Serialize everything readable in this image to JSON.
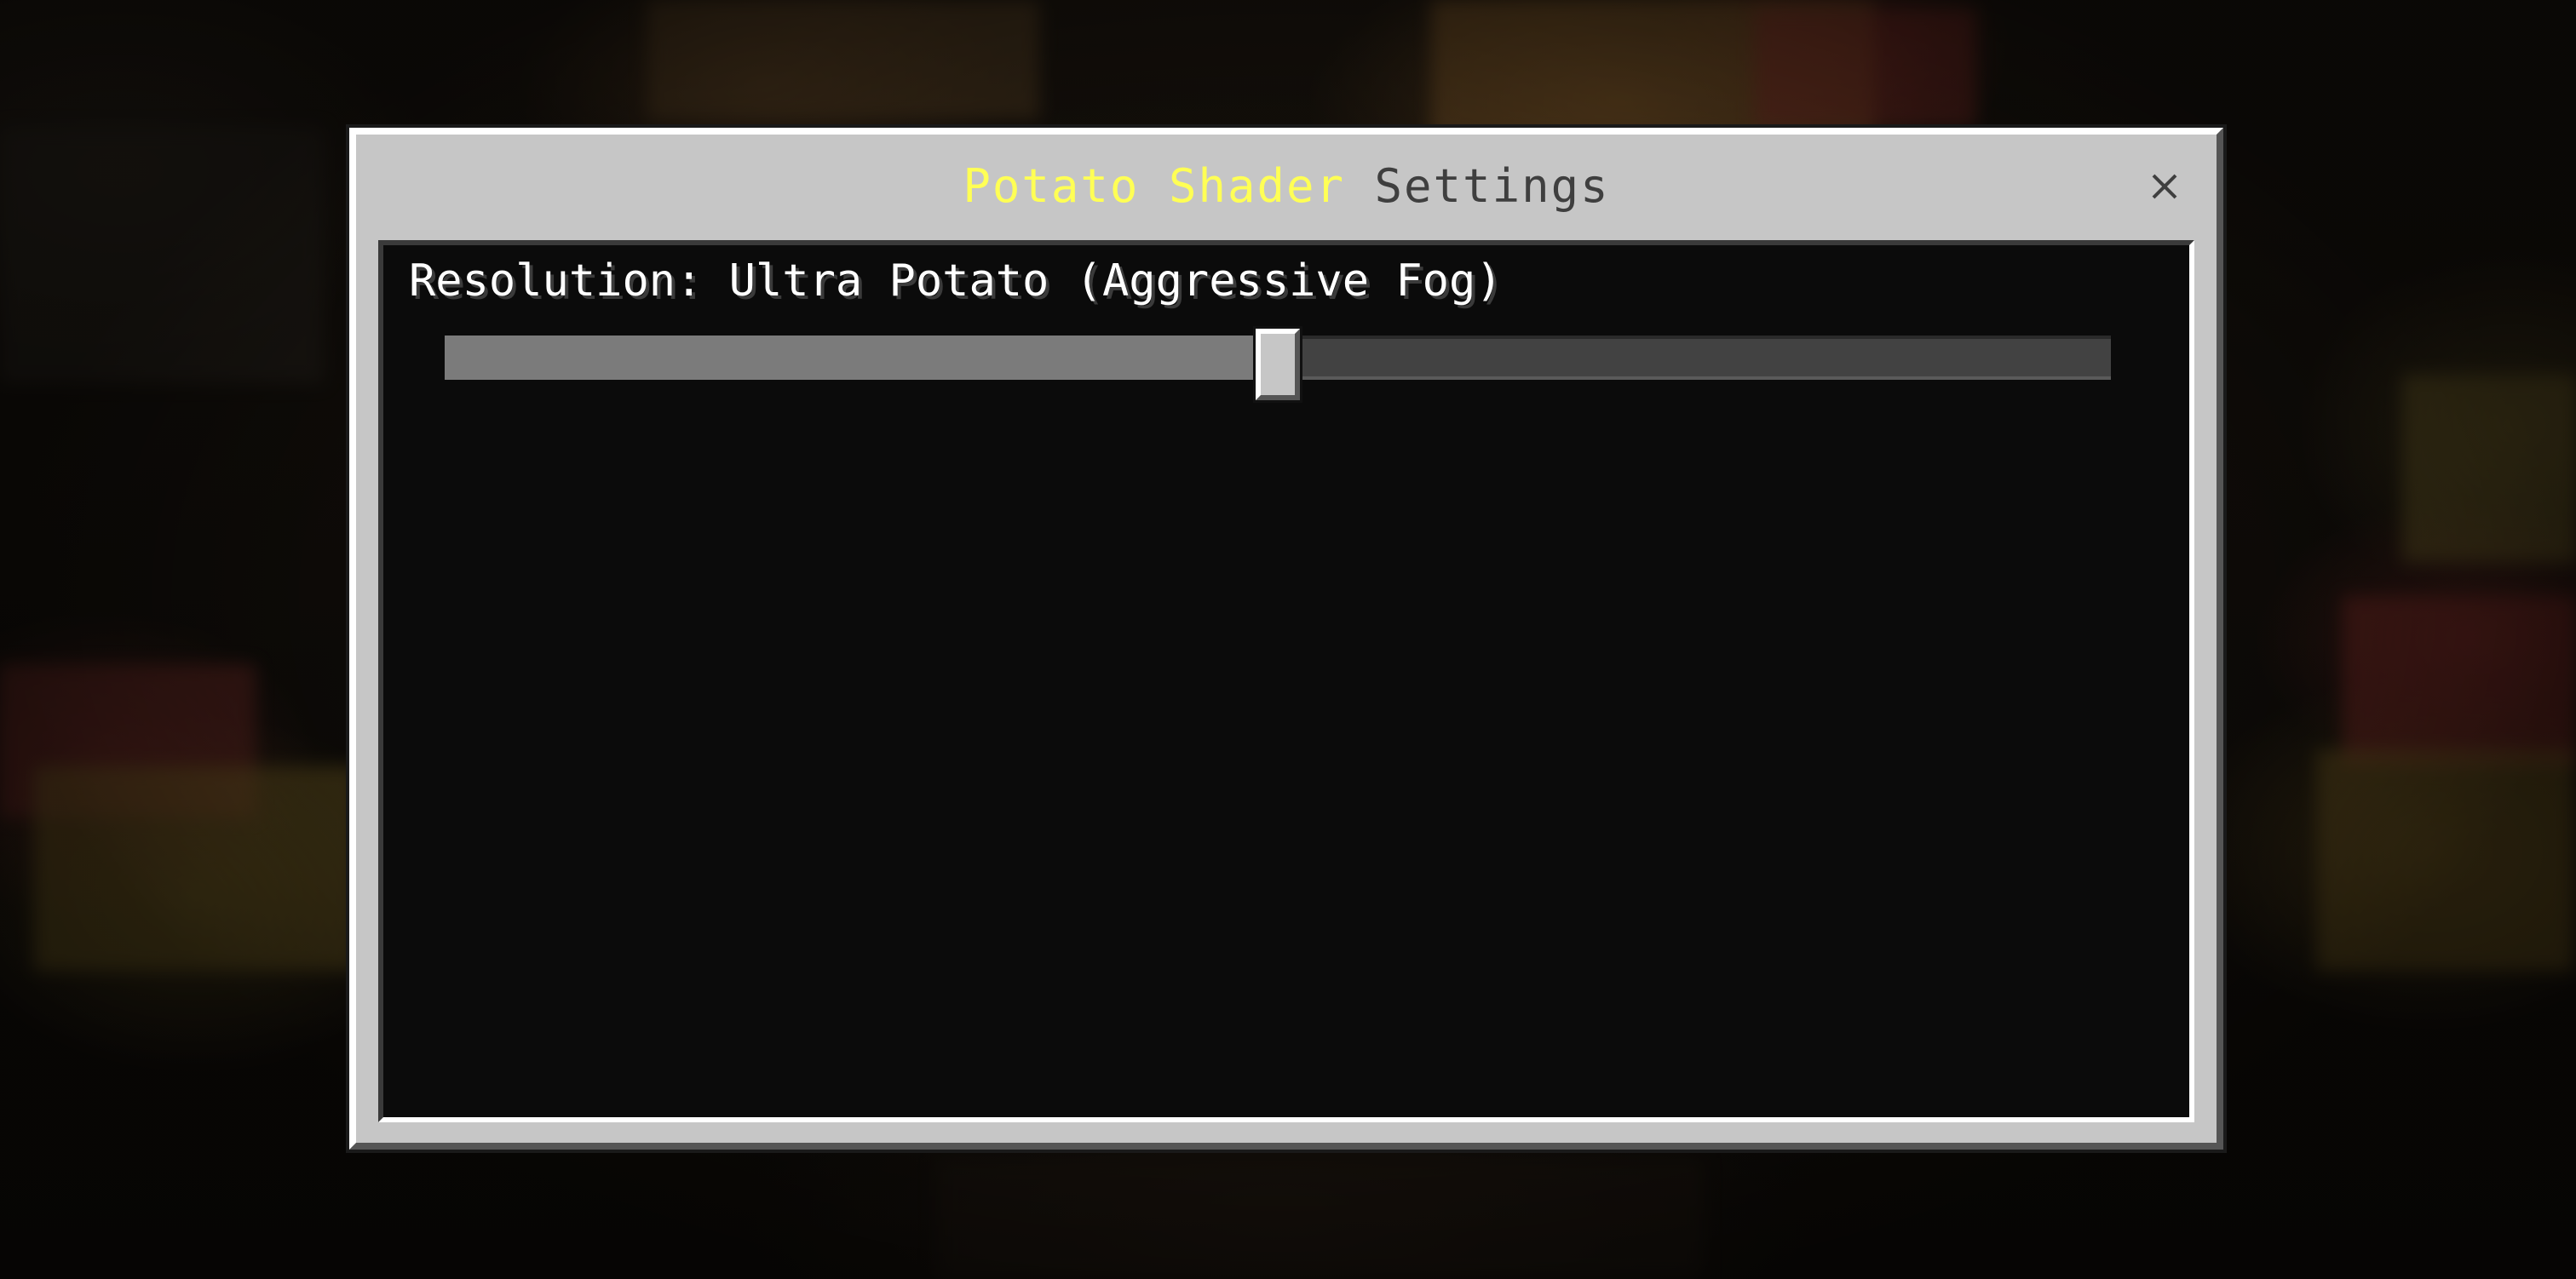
{
  "dialog": {
    "title_part_a": "Potato Shader",
    "title_part_b": " Settings",
    "close_icon": "close-icon"
  },
  "setting": {
    "label": "Resolution: Ultra Potato (Aggressive Fog)",
    "slider_value_fraction": 0.5
  },
  "colors": {
    "title_accent": "#ffff55",
    "title_rest": "#3f3f3f",
    "panel_bg": "#0b0b0b",
    "dialog_bg": "#c6c6c6"
  }
}
